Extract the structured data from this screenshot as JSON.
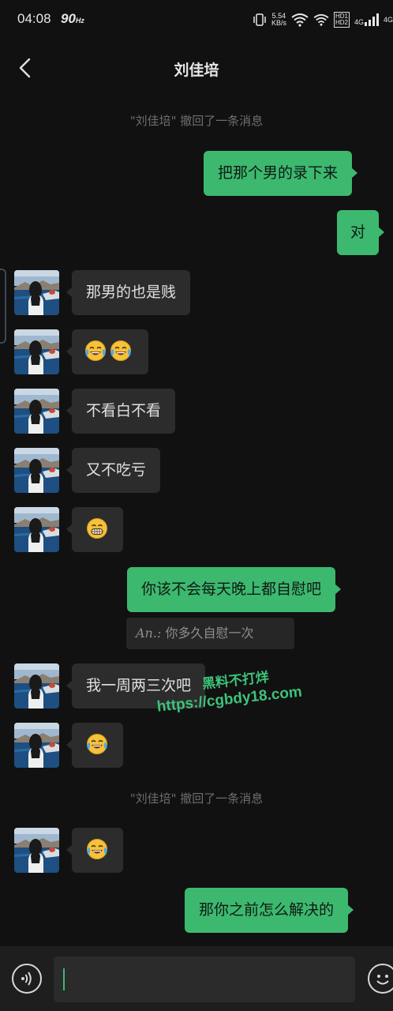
{
  "status_bar": {
    "time": "04:08",
    "refresh_rate": "90",
    "refresh_unit": "Hz",
    "net_speed_value": "5.54",
    "net_speed_unit": "KB/s",
    "hd1": "HD1",
    "hd2": "HD2",
    "sim1": "4G",
    "sim2": "4G"
  },
  "header": {
    "title": "刘佳培",
    "back_icon": "chevron-left-icon"
  },
  "system_messages": [
    "\"刘佳培\" 撤回了一条消息",
    "\"刘佳培\" 撤回了一条消息"
  ],
  "messages": [
    {
      "side": "out",
      "text": "把那个男的录下来"
    },
    {
      "side": "out",
      "text": "对"
    },
    {
      "side": "in",
      "text": "那男的也是贱"
    },
    {
      "side": "in",
      "emoji": "loudly-crying-laughing-icon",
      "count": 2
    },
    {
      "side": "in",
      "text": "不看白不看"
    },
    {
      "side": "in",
      "text": "又不吃亏"
    },
    {
      "side": "in",
      "emoji": "grimacing-grin-icon",
      "count": 1
    },
    {
      "side": "out",
      "text": "你该不会每天晚上都自慰吧"
    },
    {
      "side": "in",
      "text": "我一周两三次吧"
    },
    {
      "side": "in",
      "emoji": "loudly-crying-laughing-icon",
      "count": 1
    },
    {
      "side": "in",
      "emoji": "loudly-crying-laughing-icon",
      "count": 1
    },
    {
      "side": "out",
      "text": "那你之前怎么解决的"
    }
  ],
  "quote": {
    "author": "An.:",
    "text": "你多久自慰一次"
  },
  "watermark": {
    "line1": "黑料不打烊",
    "line2": "https://cgbdy18.com"
  },
  "input_bar": {
    "voice_icon": "voice-input-icon",
    "emoji_icon": "emoji-smile-icon",
    "value": ""
  },
  "colors": {
    "background": "#111111",
    "outgoing_bubble": "#3db86f",
    "incoming_bubble": "#2c2c2c",
    "watermark": "#3ec27a"
  }
}
